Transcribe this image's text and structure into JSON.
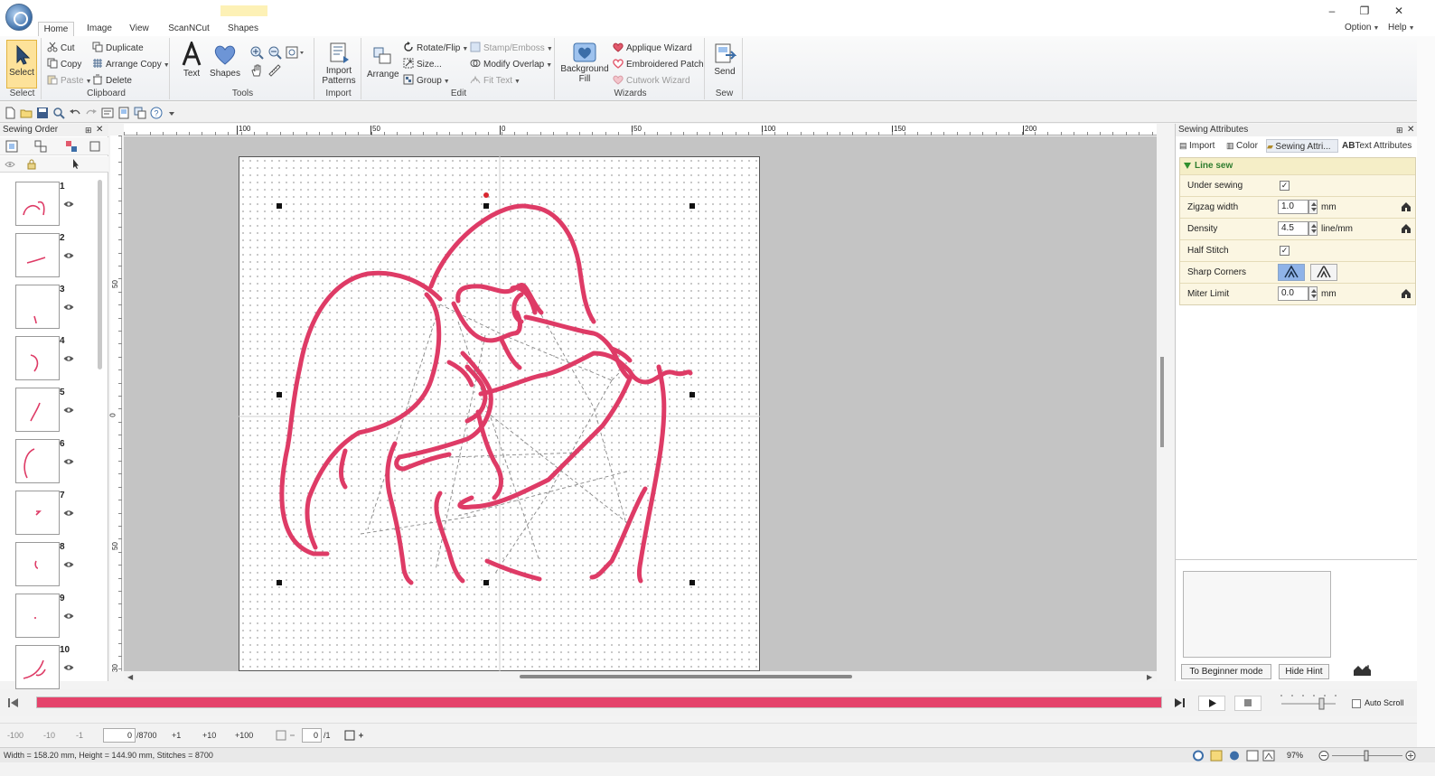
{
  "ribbon_tabs": [
    {
      "label": "Home",
      "active": true
    },
    {
      "label": "Image"
    },
    {
      "label": "View"
    },
    {
      "label": "ScanNCut"
    },
    {
      "label": "Shapes"
    }
  ],
  "top_right": {
    "option": "Option",
    "help": "Help"
  },
  "window_controls": {
    "minimize": "–",
    "restore": "❐",
    "close": "✕"
  },
  "groups": {
    "select": {
      "label": "Select",
      "button": "Select"
    },
    "clipboard": {
      "label": "Clipboard",
      "cut": "Cut",
      "copy": "Copy",
      "paste": "Paste",
      "duplicate": "Duplicate",
      "arrange_copy": "Arrange Copy",
      "delete": "Delete"
    },
    "tools": {
      "label": "Tools",
      "text": "Text",
      "shapes": "Shapes"
    },
    "import": {
      "label": "Import",
      "import_patterns_1": "Import",
      "import_patterns_2": "Patterns"
    },
    "edit": {
      "label": "Edit",
      "arrange": "Arrange",
      "rotate_flip": "Rotate/Flip",
      "size": "Size...",
      "group": "Group",
      "stamp_emboss": "Stamp/Emboss",
      "modify_overlap": "Modify Overlap",
      "fit_text": "Fit Text"
    },
    "wizards": {
      "label": "Wizards",
      "background_fill_1": "Background",
      "background_fill_2": "Fill",
      "applique": "Applique Wizard",
      "embroidered_patch": "Embroidered Patch",
      "cutwork": "Cutwork Wizard"
    },
    "sew": {
      "label": "Sew",
      "send": "Send"
    }
  },
  "left_panel": {
    "title": "Sewing Order",
    "items": [
      {
        "num": "1"
      },
      {
        "num": "2"
      },
      {
        "num": "3"
      },
      {
        "num": "4"
      },
      {
        "num": "5"
      },
      {
        "num": "6"
      },
      {
        "num": "7"
      },
      {
        "num": "8"
      },
      {
        "num": "9"
      },
      {
        "num": "10"
      }
    ]
  },
  "ruler_h": [
    "100",
    "50",
    "0",
    "50",
    "100",
    "150",
    "200"
  ],
  "ruler_v": [
    "50",
    "0",
    "50",
    "30"
  ],
  "right_panel": {
    "title": "Sewing Attributes",
    "tabs": [
      {
        "label": "Import"
      },
      {
        "label": "Color"
      },
      {
        "label": "Sewing Attri...",
        "active": true
      },
      {
        "label": "Text Attributes"
      }
    ],
    "section": "Line sew",
    "under_sewing": {
      "label": "Under sewing",
      "checked": "✓"
    },
    "zigzag_width": {
      "label": "Zigzag width",
      "value": "1.0",
      "unit": "mm"
    },
    "density": {
      "label": "Density",
      "value": "4.5",
      "unit": "line/mm"
    },
    "half_stitch": {
      "label": "Half Stitch",
      "checked": "✓"
    },
    "sharp_corners": {
      "label": "Sharp Corners"
    },
    "miter_limit": {
      "label": "Miter Limit",
      "value": "0.0",
      "unit": "mm"
    },
    "beginner_btn": "To Beginner mode",
    "hide_hint_btn": "Hide Hint"
  },
  "timeline": {
    "progress": 1.0,
    "auto_scroll": "Auto Scroll"
  },
  "stitchbar": {
    "minus100": "-100",
    "minus10": "-10",
    "minus1": "-1",
    "current": "0",
    "total": "/8700",
    "plus1": "+1",
    "plus10": "+10",
    "plus100": "+100",
    "color_current": "0",
    "color_total": "/1"
  },
  "status": {
    "text": "Width = 158.20 mm, Height = 144.90 mm, Stitches = 8700",
    "zoom": "97%"
  },
  "colors": {
    "thread": "#de3b66",
    "accent": "#3c6ea8"
  }
}
